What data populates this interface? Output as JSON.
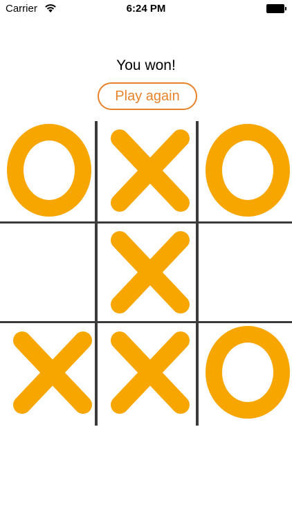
{
  "status_bar": {
    "carrier": "Carrier",
    "time": "6:24 PM",
    "wifi_icon": "wifi-icon",
    "battery_icon": "battery-icon"
  },
  "game": {
    "result": "You won!",
    "play_again_label": "Play again",
    "accent_color": "#e8822a",
    "mark_color": "#f7a600",
    "grid_color": "#3a3a3a",
    "board": [
      [
        "O",
        "X",
        "O"
      ],
      [
        "",
        "X",
        ""
      ],
      [
        "X",
        "X",
        "O"
      ]
    ]
  }
}
